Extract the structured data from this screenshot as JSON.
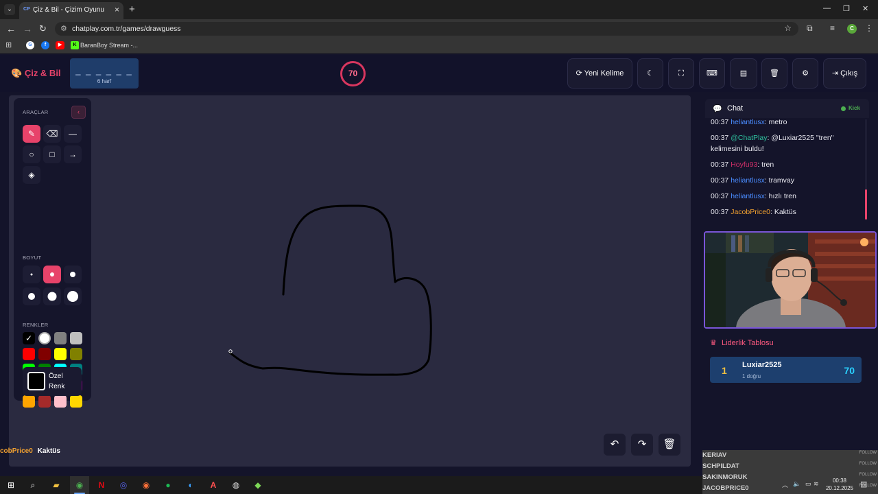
{
  "browser": {
    "tab_title": "Çiz & Bil - Çizim Oyunu",
    "tab_favicon": "CP",
    "url": "chatplay.com.tr/games/drawguess",
    "profile_initial": "C",
    "bookmark_label": "BaranBoy Stream -..."
  },
  "header": {
    "logo": "Çiz & Bil",
    "word_blanks": "_ _ _ _ _ _",
    "word_hint": "6 harf",
    "timer": "70",
    "new_word_label": "Yeni Kelime",
    "logout_label": "Çıkış"
  },
  "tools": {
    "tools_label": "ARAÇLAR",
    "size_label": "BOYUT",
    "colors_label": "RENKLER",
    "custom_color_label": "Özel Renk",
    "colors": [
      "#000000",
      "#ffffff",
      "#808080",
      "#c0c0c0",
      "#ff0000",
      "#800000",
      "#ffff00",
      "#808000",
      "#00ff00",
      "#008000",
      "#00ffff",
      "#008080",
      "#0000ff",
      "#000080",
      "#ff00ff",
      "#800080",
      "#ffa500",
      "#a52a2a",
      "#ffc0cb",
      "#ffd700"
    ]
  },
  "chat": {
    "title": "Chat",
    "platform": "Kick",
    "messages": [
      {
        "time": "00:37",
        "user": "heliantlusx",
        "user_color": "#4a8cff",
        "text": ": metro"
      },
      {
        "time": "00:37",
        "user": "@ChatPlay",
        "user_color": "#2ec4a0",
        "text": ": @Luxiar2525 \"tren\" kelimesini buldu!"
      },
      {
        "time": "00:37",
        "user": "Hoyfu93",
        "user_color": "#d4306a",
        "text": ": tren"
      },
      {
        "time": "00:37",
        "user": "heliantlusx",
        "user_color": "#4a8cff",
        "text": ": tramvay"
      },
      {
        "time": "00:37",
        "user": "heliantlusx",
        "user_color": "#4a8cff",
        "text": ": hızlı tren"
      },
      {
        "time": "00:37",
        "user": "JacobPrice0",
        "user_color": "#f0a030",
        "text": ": Kaktüs"
      }
    ]
  },
  "leaderboard": {
    "title": "Liderlik Tablosu",
    "entries": [
      {
        "rank": "1",
        "name": "Luxiar2525",
        "correct": "1 doğru",
        "score": "70"
      }
    ]
  },
  "overlay": {
    "user": "cobPrice0",
    "text": "Kaktüs"
  },
  "follow_list": [
    {
      "name": "KERIAV",
      "action": "FOLLOW"
    },
    {
      "name": "SCHPILDAT",
      "action": "FOLLOW"
    },
    {
      "name": "SAKINMORUK",
      "action": "FOLLOW"
    },
    {
      "name": "JACOBPRICE0",
      "action": "FOLLOW"
    }
  ],
  "taskbar": {
    "time": "00:38",
    "date": "20.12.2025"
  },
  "colors": {
    "accent": "#e7436a",
    "bg": "#14142a",
    "canvas": "#2a2a40"
  }
}
